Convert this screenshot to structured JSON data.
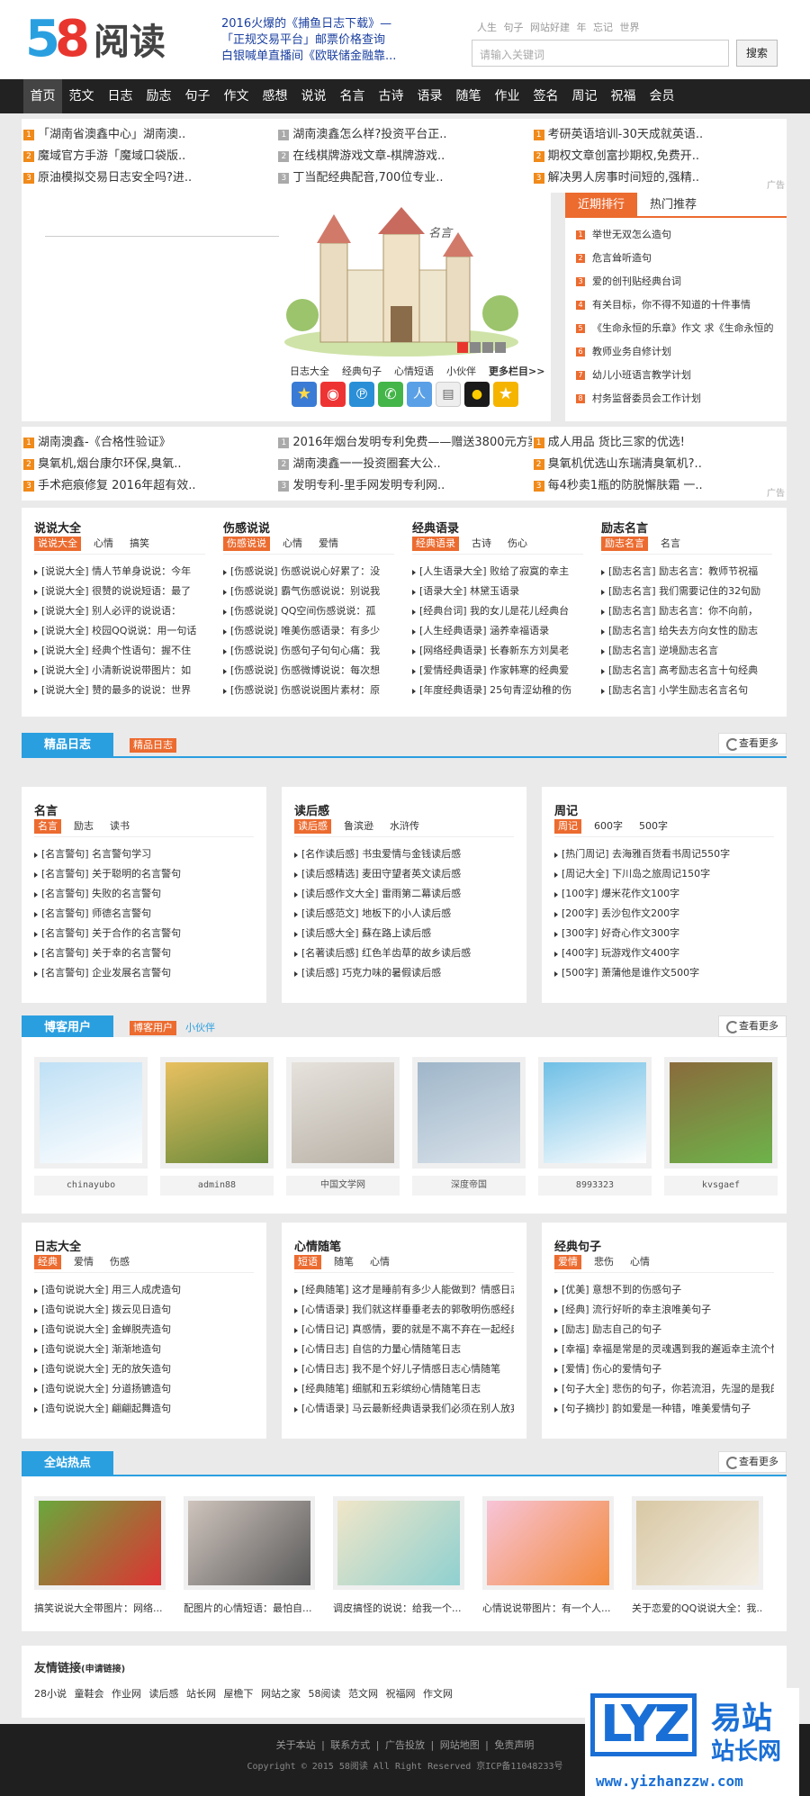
{
  "header": {
    "logo": {
      "n5": "5",
      "n8": "8",
      "txt": "阅读"
    },
    "hot_headlines": [
      "2016火爆的《捕鱼日志下载》—",
      "「正规交易平台」邮票价格查询",
      "白银喊单直播间《欧联储金融靠..."
    ],
    "top_links": "人生 句子 网站好建 年 忘记 世界",
    "search_placeholder": "请输入关键词",
    "search_button": "搜索"
  },
  "nav": [
    "首页",
    "范文",
    "日志",
    "励志",
    "句子",
    "作文",
    "感想",
    "说说",
    "名言",
    "古诗",
    "语录",
    "随笔",
    "作业",
    "签名",
    "周记",
    "祝福",
    "会员"
  ],
  "ad_rows_top": [
    [
      "「湖南省澳鑫中心」湖南澳..",
      "湖南澳鑫怎么样?投资平台正..",
      "考研英语培训-30天成就英语.."
    ],
    [
      "魔域官方手游「魔域口袋版..",
      "在线棋牌游戏文章-棋牌游戏..",
      "期权文章创富抄期权,免费开.."
    ],
    [
      "原油模拟交易日志安全吗?进..",
      "丁当配经典配音,700位专业..",
      "解决男人房事时间短的,强精.."
    ]
  ],
  "ad_tag": "广告",
  "banner": {
    "tag": "名言",
    "links": [
      "日志大全",
      "经典句子",
      "心情短语",
      "小伙伴"
    ],
    "more": "更多栏目>>"
  },
  "rank": {
    "tabs": [
      "近期排行",
      "热门推荐"
    ],
    "items": [
      "举世无双怎么造句",
      "危言耸听造句",
      "爱的创刊贴经典台词",
      "有关目标，你不得不知道的十件事情",
      "《生命永恒的乐章》作文 求《生命永恒的",
      "教师业务自修计划",
      "幼儿小班语言教学计划",
      "村务监督委员会工作计划"
    ]
  },
  "ad_rows_mid": [
    [
      "湖南澳鑫-《合格性验证》",
      "2016年烟台发明专利免费——赠送3800元方案!",
      "成人用品 货比三家的优选!"
    ],
    [
      "臭氧机,烟台康尔环保,臭氧..",
      "湖南澳鑫一一投资圈套大公..",
      "臭氧机优选山东瑞清臭氧机?.."
    ],
    [
      "手术疤痕修复 2016年超有效..",
      "发明专利-里手网发明专利网..",
      "每4秒卖1瓶的防脱懈肤霜 一.."
    ]
  ],
  "cols4": [
    {
      "title": "说说大全",
      "tabs": [
        "说说大全",
        "心情",
        "搞笑"
      ],
      "items": [
        "[说说大全] 情人节单身说说：今年",
        "[说说大全] 很赞的说说短语：最了",
        "[说说大全] 别人必评的说说语：",
        "[说说大全] 校园QQ说说：用一句话",
        "[说说大全] 经典个性语句：握不住",
        "[说说大全] 小清新说说带图片：如",
        "[说说大全] 赞的最多的说说：世界"
      ]
    },
    {
      "title": "伤感说说",
      "tabs": [
        "伤感说说",
        "心情",
        "爱情"
      ],
      "items": [
        "[伤感说说] 伤感说说心好累了：没",
        "[伤感说说] 霸气伤感说说：别说我",
        "[伤感说说] QQ空间伤感说说：孤",
        "[伤感说说] 唯美伤感语录：有多少",
        "[伤感说说] 伤感句子句句心痛：我",
        "[伤感说说] 伤感微博说说：每次想",
        "[伤感说说] 伤感说说图片素材：原"
      ]
    },
    {
      "title": "经典语录",
      "tabs": [
        "经典语录",
        "古诗",
        "伤心"
      ],
      "items": [
        "[人生语录大全] 败给了寂寞的幸主",
        "[语录大全] 林黛玉语录",
        "[经典台词] 我的女儿是花儿经典台",
        "[人生经典语录] 涵养幸福语录",
        "[网络经典语录] 长春新东方刘昊老",
        "[爱情经典语录] 作家韩寒的经典爱",
        "[年度经典语录] 25句青涩幼稚的伤"
      ]
    },
    {
      "title": "励志名言",
      "tabs": [
        "励志名言",
        "名言"
      ],
      "items": [
        "[励志名言] 励志名言：教师节祝福",
        "[励志名言] 我们需要记住的32句励",
        "[励志名言] 励志名言：你不向前，",
        "[励志名言] 给失去方向女性的励志",
        "[励志名言] 逆境励志名言",
        "[励志名言] 高考励志名言十句经典",
        "[励志名言] 小学生励志名言名句"
      ]
    }
  ],
  "sec1": {
    "title": "精品日志",
    "sub": [
      "精品日志"
    ],
    "more": "查看更多"
  },
  "cols3a": [
    {
      "title": "名言",
      "tabs": [
        "名言",
        "励志",
        "读书"
      ],
      "items": [
        "[名言警句] 名言警句学习",
        "[名言警句] 关于聪明的名言警句",
        "[名言警句] 失败的名言警句",
        "[名言警句] 师德名言警句",
        "[名言警句] 关于合作的名言警句",
        "[名言警句] 关于幸的名言警句",
        "[名言警句] 企业发展名言警句"
      ]
    },
    {
      "title": "读后感",
      "tabs": [
        "读后感",
        "鲁滨逊",
        "水浒传"
      ],
      "items": [
        "[名作读后感] 书虫爱情与金钱读后感",
        "[读后感精选] 麦田守望者英文读后感",
        "[读后感作文大全] 雷雨第二幕读后感",
        "[读后感范文] 地板下的小人读后感",
        "[读后感大全] 蘇在路上读后感",
        "[名著读后感] 红色羊齿草的故乡读后感",
        "[读后感] 巧克力味的暑假读后感"
      ]
    },
    {
      "title": "周记",
      "tabs": [
        "周记",
        "600字",
        "500字"
      ],
      "items": [
        "[热门周记] 去海雅百货看书周记550字",
        "[周记大全] 下川岛之旅周记150字",
        "[100字] 爆米花作文100字",
        "[200字] 丢沙包作文200字",
        "[300字] 好奇心作文300字",
        "[400字] 玩游戏作文400字",
        "[500字] 萧蒲他是谁作文500字"
      ]
    }
  ],
  "sec2": {
    "title": "博客用户",
    "sub": [
      "博客用户",
      "小伙伴"
    ],
    "more": "查看更多"
  },
  "users": [
    "chinayubo",
    "admin88",
    "中国文学网",
    "深度帝国",
    "8993323",
    "kvsgaef"
  ],
  "cols3b": [
    {
      "title": "日志大全",
      "tabs": [
        "经典",
        "爱情",
        "伤感"
      ],
      "items": [
        "[造句说说大全] 用三人成虎造句",
        "[造句说说大全] 拨云见日造句",
        "[造句说说大全] 金蝉脱壳造句",
        "[造句说说大全] 渐渐地造句",
        "[造句说说大全] 无的放矢造句",
        "[造句说说大全] 分道扬镳造句",
        "[造句说说大全] 翩翩起舞造句"
      ]
    },
    {
      "title": "心情随笔",
      "tabs": [
        "短语",
        "随笔",
        "心情"
      ],
      "items": [
        "[经典随笔] 这才是睡前有多少人能做到？情感日志",
        "[心情语录] 我们就这样垂垂老去的郭敬明伤感经典",
        "[心情日记] 真感情，要的就是不离不弃在一起经典",
        "[心情日志] 自信的力量心情随笔日志",
        "[心情日志] 我不是个好儿子情感日志心情随笔",
        "[经典随笔] 细腻和五彩缤纷心情随笔日志",
        "[心情语录] 马云最新经典语录我们必须在别人放弃"
      ]
    },
    {
      "title": "经典句子",
      "tabs": [
        "爱情",
        "悲伤",
        "心情"
      ],
      "items": [
        "[优美] 意想不到的伤感句子",
        "[经典] 流行好听的幸主浪唯美句子",
        "[励志] 励志自己的句子",
        "[幸福] 幸福是常是的灵魂遇到我的邂逅幸主流个性",
        "[爱情] 伤心的爱情句子",
        "[句子大全] 悲伤的句子，你若流泪，先湿的是我的",
        "[句子摘抄] 韵如爱是一种错，唯美爱情句子"
      ]
    }
  ],
  "sec3": {
    "title": "全站热点",
    "more": "查看更多"
  },
  "hotpics": [
    "搞笑说说大全带图片：网络...",
    "配图片的心情短语：最怕自...",
    "调皮搞怪的说说：给我一个...",
    "心情说说带图片：有一个人...",
    "关于恋爱的QQ说说大全：我..."
  ],
  "friends": {
    "title": "友情链接",
    "sub": "(申请链接)",
    "links": "28小说 童鞋会 作业网 读后感 站长网 屋檐下 网站之家 58阅读 范文网 祝福网 作文网"
  },
  "footer": {
    "links": "关于本站 | 联系方式 | 广告投放 | 网站地图 | 免责声明",
    "copyright": "Copyright © 2015 58阅读 All Right Reserved 京ICP备11048233号"
  },
  "watermark": {
    "logo": "LYZ",
    "cn1": "易站",
    "cn2": "站长网",
    "url": "www.yizhanzzw.com"
  },
  "colors": {
    "accent": "#2a9fe0",
    "orange": "#ec6b2f",
    "nav": "#222222"
  }
}
